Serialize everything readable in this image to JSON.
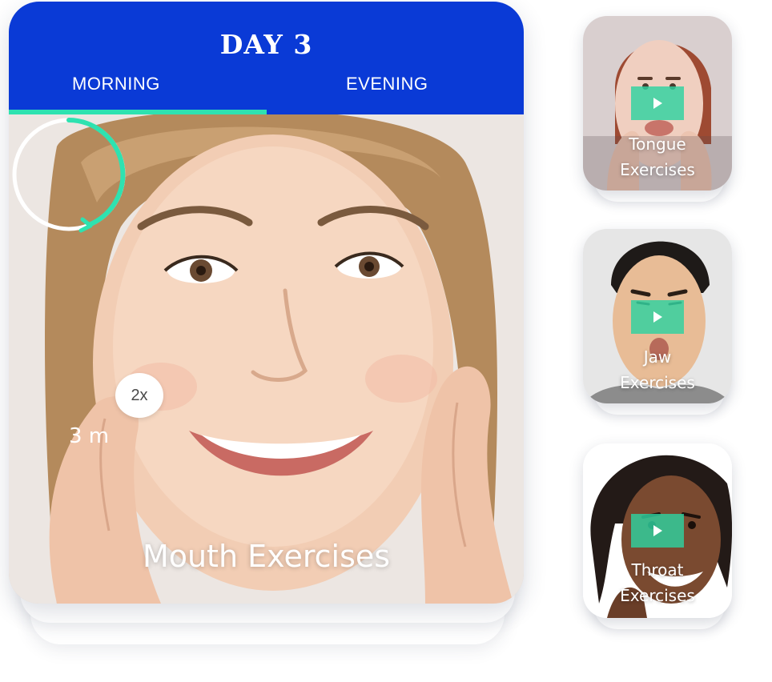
{
  "day": {
    "title": "DAY 3"
  },
  "tabs": [
    {
      "label": "MORNING",
      "active": true
    },
    {
      "label": "EVENING",
      "active": false
    }
  ],
  "main_exercise": {
    "title": "Mouth Exercises",
    "timer": "3 m",
    "reps": "2x"
  },
  "exercises": [
    {
      "label_line1": "Tongue",
      "label_line2": "Exercises"
    },
    {
      "label_line1": "Jaw",
      "label_line2": "Exercises"
    },
    {
      "label_line1": "Throat",
      "label_line2": "Exercises"
    }
  ],
  "colors": {
    "header": "#0a3ad6",
    "accent": "#2ee2b0",
    "play_button": "#2ed2a0"
  },
  "icons": {
    "play": "play-icon"
  }
}
